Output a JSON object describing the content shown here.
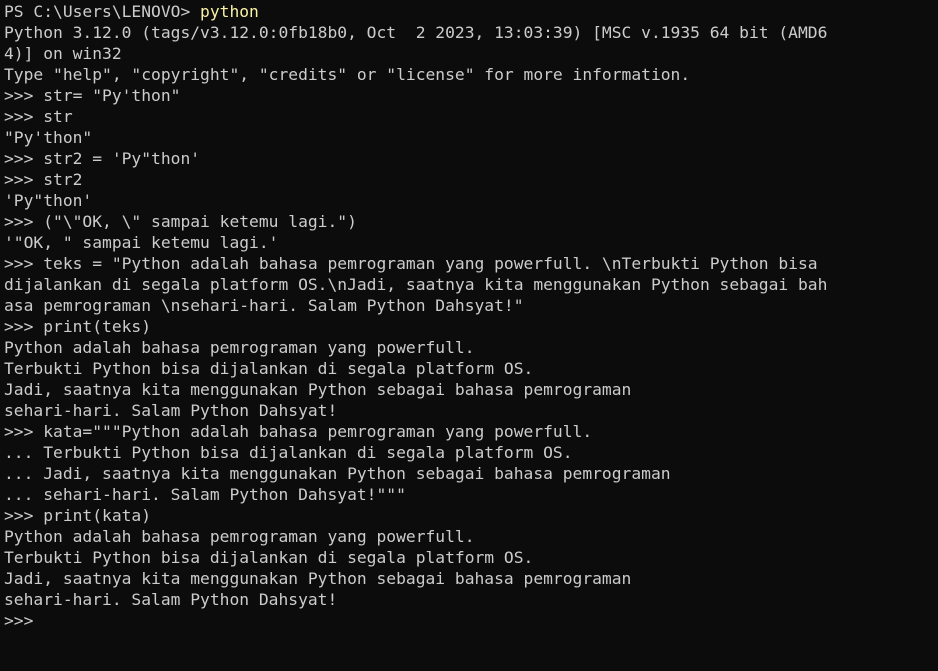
{
  "terminal": {
    "prompt_line": {
      "prompt": "PS C:\\Users\\LENOVO> ",
      "command": "python"
    },
    "lines": [
      "Python 3.12.0 (tags/v3.12.0:0fb18b0, Oct  2 2023, 13:03:39) [MSC v.1935 64 bit (AMD6",
      "4)] on win32",
      "Type \"help\", \"copyright\", \"credits\" or \"license\" for more information.",
      ">>> str= \"Py'thon\"",
      ">>> str",
      "\"Py'thon\"",
      ">>> str2 = 'Py\"thon'",
      ">>> str2",
      "'Py\"thon'",
      ">>> (\"\\\"OK, \\\" sampai ketemu lagi.\")",
      "'\"OK, \" sampai ketemu lagi.'",
      ">>> teks = \"Python adalah bahasa pemrograman yang powerfull. \\nTerbukti Python bisa",
      "dijalankan di segala platform OS.\\nJadi, saatnya kita menggunakan Python sebagai bah",
      "asa pemrograman \\nsehari-hari. Salam Python Dahsyat!\"",
      ">>> print(teks)",
      "Python adalah bahasa pemrograman yang powerfull.",
      "Terbukti Python bisa dijalankan di segala platform OS.",
      "Jadi, saatnya kita menggunakan Python sebagai bahasa pemrograman",
      "sehari-hari. Salam Python Dahsyat!",
      ">>> kata=\"\"\"Python adalah bahasa pemrograman yang powerfull.",
      "... Terbukti Python bisa dijalankan di segala platform OS.",
      "... Jadi, saatnya kita menggunakan Python sebagai bahasa pemrograman",
      "... sehari-hari. Salam Python Dahsyat!\"\"\"",
      ">>> print(kata)",
      "Python adalah bahasa pemrograman yang powerfull.",
      "Terbukti Python bisa dijalankan di segala platform OS.",
      "Jadi, saatnya kita menggunakan Python sebagai bahasa pemrograman",
      "sehari-hari. Salam Python Dahsyat!"
    ],
    "final_prompt": ">>> ",
    "colors": {
      "background": "#0c0c0c",
      "text": "#cccccc",
      "command": "#f9f1a5"
    }
  }
}
